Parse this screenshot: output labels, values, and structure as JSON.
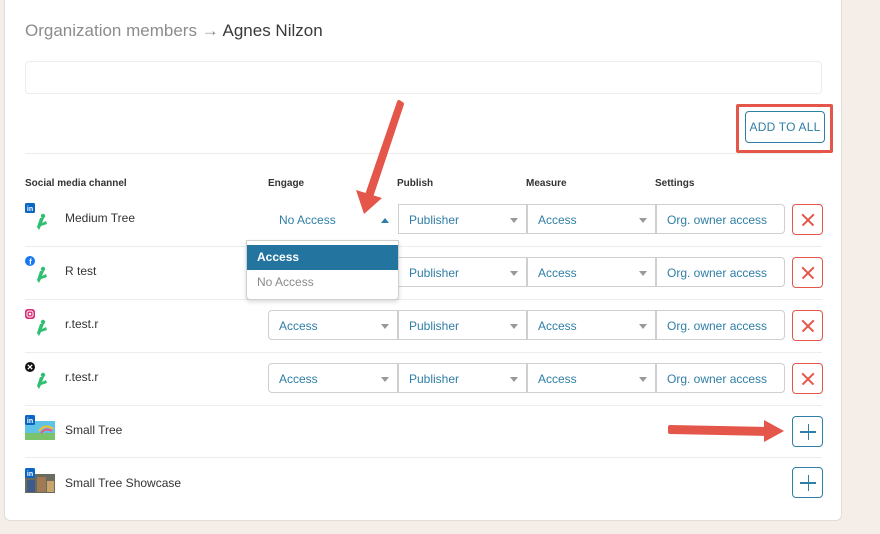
{
  "breadcrumb": {
    "parent": "Organization members",
    "separator": "→",
    "current": "Agnes Nilzon"
  },
  "toolbar": {
    "add_to_all_label": "ADD TO ALL"
  },
  "columns": {
    "channel": "Social media channel",
    "engage": "Engage",
    "publish": "Publish",
    "measure": "Measure",
    "settings": "Settings"
  },
  "rows": [
    {
      "name": "Medium Tree",
      "network": "linkedin",
      "engage": "No Access",
      "publish": "Publisher",
      "measure": "Access",
      "settings": "Org. owner access"
    },
    {
      "name": "R test",
      "network": "facebook",
      "engage": "Access",
      "publish": "Publisher",
      "measure": "Access",
      "settings": "Org. owner access"
    },
    {
      "name": "r.test.r",
      "network": "instagram",
      "engage": "Access",
      "publish": "Publisher",
      "measure": "Access",
      "settings": "Org. owner access"
    },
    {
      "name": "r.test.r",
      "network": "x",
      "engage": "Access",
      "publish": "Publisher",
      "measure": "Access",
      "settings": "Org. owner access"
    },
    {
      "name": "Small Tree",
      "network": "linkedin"
    },
    {
      "name": "Small Tree Showcase",
      "network": "linkedin"
    }
  ],
  "engage_dropdown": {
    "options": [
      "Access",
      "No Access"
    ],
    "highlighted": "Access"
  },
  "colors": {
    "accent": "#2f7ea6",
    "danger": "#e5564a",
    "annotation": "#e5564a",
    "background": "#f4ede8"
  }
}
